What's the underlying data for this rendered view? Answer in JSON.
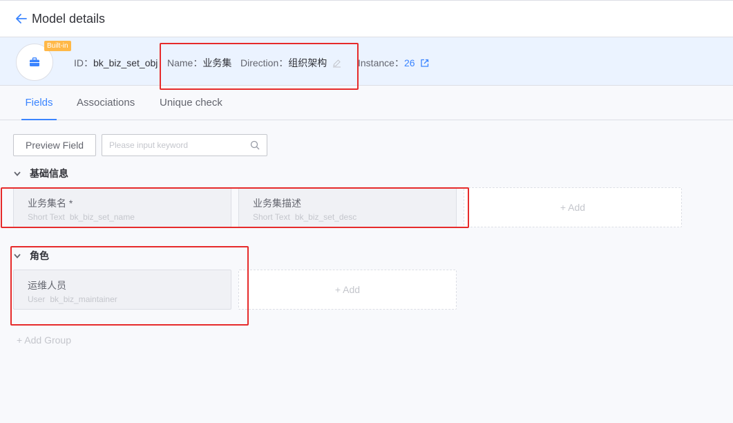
{
  "header": {
    "title": "Model details"
  },
  "model": {
    "badge": "Built-in",
    "id_label": "ID：",
    "id_value": "bk_biz_set_obj",
    "name_label": "Name：",
    "name_value": "业务集",
    "direction_label": "Direction：",
    "direction_value": "组织架构",
    "instance_label": "Instance：",
    "instance_value": "26"
  },
  "tabs": [
    {
      "label": "Fields",
      "active": true
    },
    {
      "label": "Associations",
      "active": false
    },
    {
      "label": "Unique check",
      "active": false
    }
  ],
  "toolbar": {
    "preview_label": "Preview Field",
    "search_placeholder": "Please input keyword"
  },
  "groups": [
    {
      "title": "基础信息",
      "fields": [
        {
          "name": "业务集名 *",
          "type": "Short Text",
          "id": "bk_biz_set_name"
        },
        {
          "name": "业务集描述",
          "type": "Short Text",
          "id": "bk_biz_set_desc"
        }
      ],
      "add_label": "+ Add"
    },
    {
      "title": "角色",
      "fields": [
        {
          "name": "运维人员",
          "type": "User",
          "id": "bk_biz_maintainer"
        }
      ],
      "add_label": "+ Add"
    }
  ],
  "add_group_label": "+ Add Group",
  "colors": {
    "accent": "#3a84ff",
    "badge": "#ffb848",
    "highlight": "#e62a2a"
  }
}
